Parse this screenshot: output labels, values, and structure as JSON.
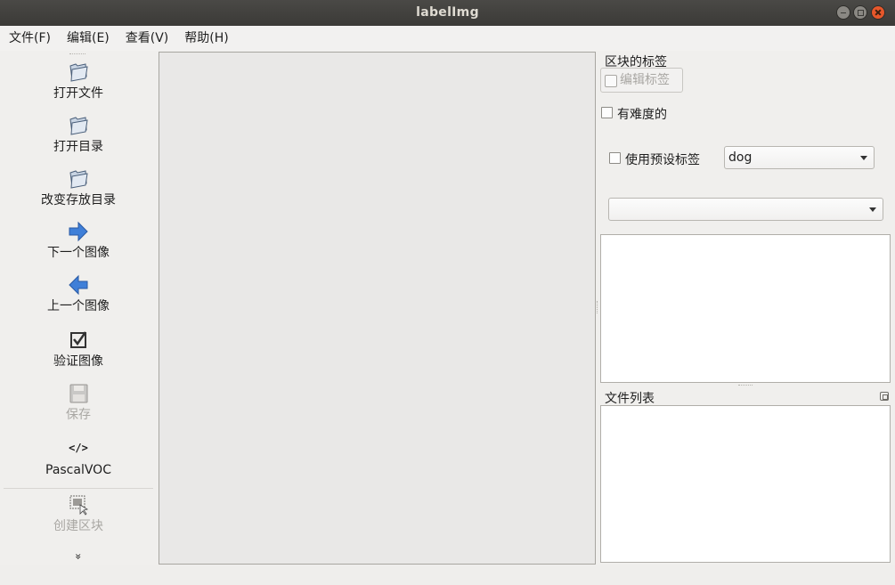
{
  "window": {
    "title": "labelImg"
  },
  "menu": [
    {
      "label": "文件(F)"
    },
    {
      "label": "编辑(E)"
    },
    {
      "label": "查看(V)"
    },
    {
      "label": "帮助(H)"
    }
  ],
  "toolbar": {
    "open_file": "打开文件",
    "open_dir": "打开目录",
    "change_save_dir": "改变存放目录",
    "next_image": "下一个图像",
    "prev_image": "上一个图像",
    "verify_image": "验证图像",
    "save": "保存",
    "format_icon_text": "</>",
    "format": "PascalVOC",
    "create_box": "创建区块",
    "more_icon_text": "»"
  },
  "right_panel": {
    "box_labels_title": "区块的标签",
    "edit_label_button": "编辑标签",
    "difficult_label": "有难度的",
    "use_default_label": "使用预设标签",
    "default_label_value": "dog",
    "label_combo_value": "",
    "file_list_title": "文件列表"
  },
  "colors": {
    "titlebar": "#3b3a37",
    "close_button": "#e6572b",
    "canvas": "#e9e8e7",
    "arrow_blue": "#3f7fd8"
  }
}
